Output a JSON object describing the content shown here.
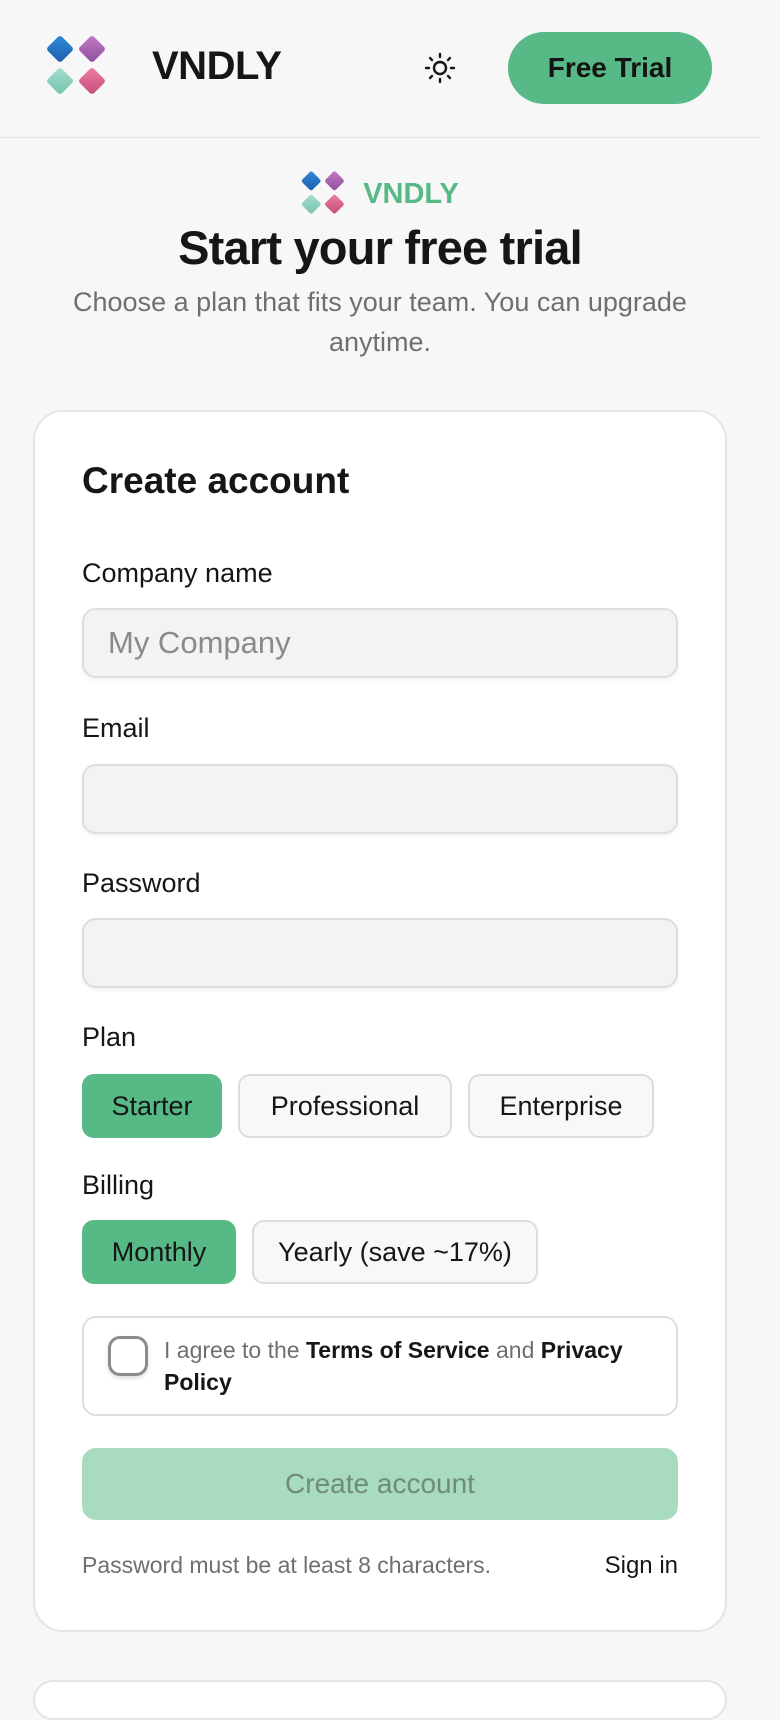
{
  "header": {
    "brand": "VNDLY",
    "free_trial_label": "Free Trial",
    "theme_icon": "sun-icon"
  },
  "hero": {
    "brand": "VNDLY",
    "title": "Start your free trial",
    "subtitle": "Choose a plan that fits your team. You can upgrade anytime."
  },
  "form": {
    "title": "Create account",
    "company": {
      "label": "Company name",
      "placeholder": "My Company",
      "value": ""
    },
    "email": {
      "label": "Email",
      "placeholder": "",
      "value": ""
    },
    "password": {
      "label": "Password",
      "placeholder": "",
      "value": ""
    },
    "plan": {
      "label": "Plan",
      "options": [
        "Starter",
        "Professional",
        "Enterprise"
      ],
      "selected": "Starter"
    },
    "billing": {
      "label": "Billing",
      "options": [
        "Monthly",
        "Yearly (save ~17%)"
      ],
      "selected": "Monthly"
    },
    "agree": {
      "checked": false,
      "prefix": "I agree to the",
      "terms": "Terms of Service",
      "and": "and",
      "privacy": "Privacy Policy"
    },
    "submit_label": "Create account",
    "hint": "Password must be at least 8 characters.",
    "signin_label": "Sign in"
  },
  "colors": {
    "accent": "#57b986",
    "accent_disabled": "#a9dbc1",
    "logo_blue": "#2f7fd0",
    "logo_purple": "#b067b5",
    "logo_teal": "#8fd0bf",
    "logo_pink": "#d9638f"
  }
}
